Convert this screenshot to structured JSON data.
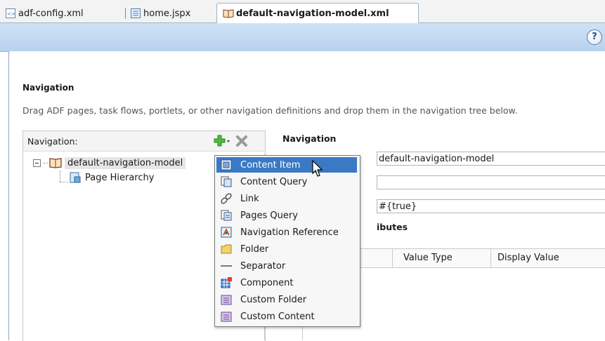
{
  "tabs": [
    {
      "label": "adf-config.xml",
      "icon": "xml-file-icon"
    },
    {
      "label": "home.jspx",
      "icon": "jspx-file-icon"
    },
    {
      "label": "default-navigation-model.xml",
      "icon": "book-icon",
      "active": true
    }
  ],
  "toolbar": {
    "help_label": "?"
  },
  "section": {
    "title": "Navigation",
    "instructions": "Drag ADF pages, task flows, portlets, or other navigation definitions and drop them in the navigation tree below."
  },
  "nav_panel": {
    "label": "Navigation:",
    "tree": {
      "root": "default-navigation-model",
      "children": [
        "Page Hierarchy"
      ]
    }
  },
  "properties": {
    "heading": "Navigation",
    "fields": [
      "default-navigation-model",
      "",
      "#{true}"
    ],
    "attributes_heading": "ibutes",
    "columns": [
      "Value Type",
      "Display Value"
    ]
  },
  "add_menu": {
    "items": [
      {
        "label": "Content Item",
        "icon": "content-item-icon",
        "highlighted": true
      },
      {
        "label": "Content Query",
        "icon": "content-query-icon"
      },
      {
        "label": "Link",
        "icon": "link-icon"
      },
      {
        "label": "Pages Query",
        "icon": "pages-query-icon"
      },
      {
        "label": "Navigation Reference",
        "icon": "navigation-reference-icon"
      },
      {
        "label": "Folder",
        "icon": "folder-icon"
      },
      {
        "label": "Separator",
        "icon": "separator-icon"
      },
      {
        "label": "Component",
        "icon": "component-icon"
      },
      {
        "label": "Custom Folder",
        "icon": "custom-folder-icon"
      },
      {
        "label": "Custom Content",
        "icon": "custom-content-icon"
      }
    ]
  },
  "colors": {
    "highlight": "#3a79c4",
    "toolbar_blue": "#c4dcf3"
  }
}
